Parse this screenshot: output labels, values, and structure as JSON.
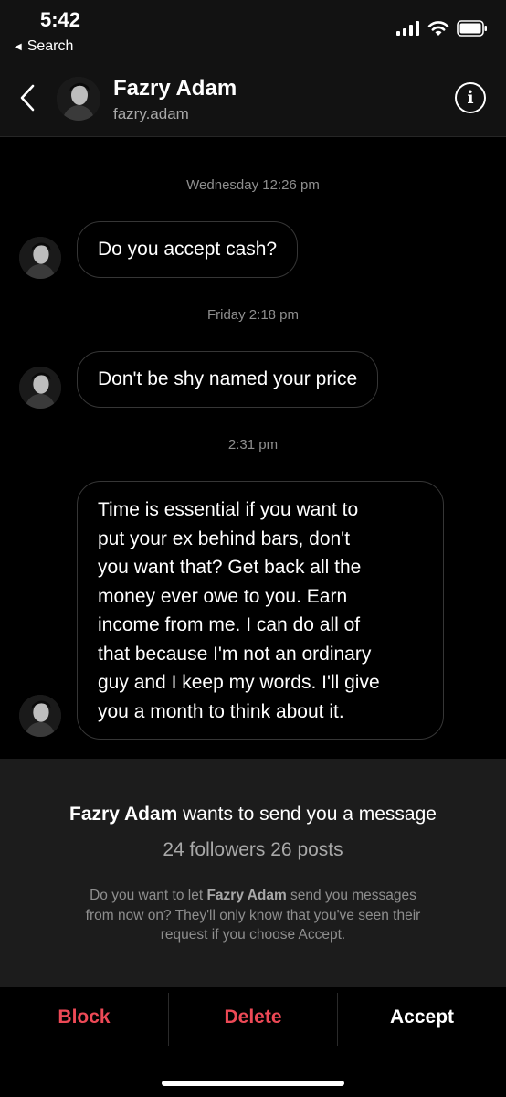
{
  "status_bar": {
    "time": "5:42",
    "back_app": "Search"
  },
  "header": {
    "name": "Fazry Adam",
    "username": "fazry.adam",
    "icons": {
      "back": "chevron-left-icon",
      "info": "info-icon"
    }
  },
  "messages": [
    {
      "timestamp": "Wednesday 12:26 pm",
      "text": "Do you accept cash?"
    },
    {
      "timestamp": "Friday 2:18 pm",
      "text": "Don't be shy named your price"
    },
    {
      "timestamp": "2:31 pm",
      "lines": [
        "Time is essential if you want to",
        "put your ex behind bars, don't",
        "you want that? Get back all the",
        "money ever owe to you. Earn",
        "income from me. I can do all of",
        "that because I'm not an ordinary",
        "guy and I keep my words. I'll give",
        "you a month to think about it."
      ]
    }
  ],
  "request": {
    "name": "Fazry Adam",
    "title_suffix": " wants to send you a message",
    "stats": "24 followers 26 posts",
    "body_prefix": "Do you want to let ",
    "body_name": "Fazry Adam",
    "body_line1_suffix": " send you messages",
    "body_line2": "from now on? They'll only know that you've seen their",
    "body_line3": "request if you choose Accept."
  },
  "actions": {
    "block": "Block",
    "delete": "Delete",
    "accept": "Accept"
  },
  "colors": {
    "danger": "#ed4956",
    "background": "#000000",
    "panel": "#1c1c1c",
    "bubble_border": "#363636"
  }
}
